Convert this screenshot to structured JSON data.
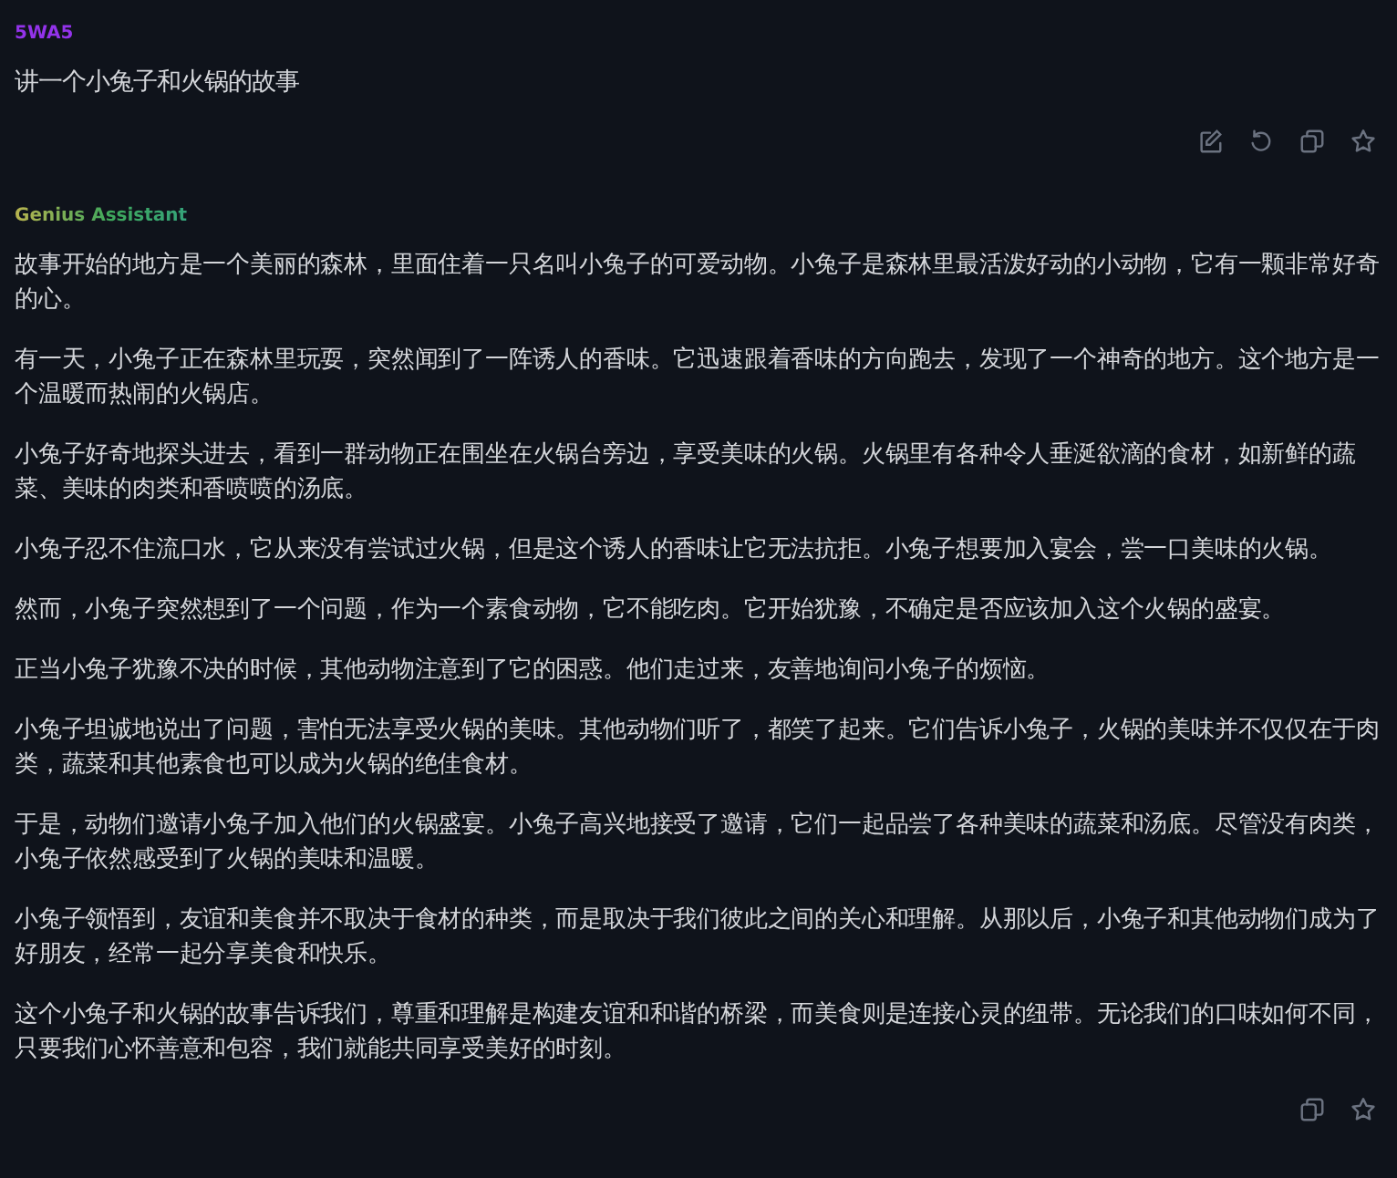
{
  "user_message": {
    "author": "5WA5",
    "text": "讲一个小兔子和火锅的故事",
    "actions": [
      {
        "kind": "edit"
      },
      {
        "kind": "regenerate"
      },
      {
        "kind": "copy"
      },
      {
        "kind": "favorite"
      }
    ]
  },
  "assistant_message": {
    "author": "Genius Assistant",
    "paragraphs": [
      "故事开始的地方是一个美丽的森林，里面住着一只名叫小兔子的可爱动物。小兔子是森林里最活泼好动的小动物，它有一颗非常好奇的心。",
      "有一天，小兔子正在森林里玩耍，突然闻到了一阵诱人的香味。它迅速跟着香味的方向跑去，发现了一个神奇的地方。这个地方是一个温暖而热闹的火锅店。",
      "小兔子好奇地探头进去，看到一群动物正在围坐在火锅台旁边，享受美味的火锅。火锅里有各种令人垂涎欲滴的食材，如新鲜的蔬菜、美味的肉类和香喷喷的汤底。",
      "小兔子忍不住流口水，它从来没有尝试过火锅，但是这个诱人的香味让它无法抗拒。小兔子想要加入宴会，尝一口美味的火锅。",
      "然而，小兔子突然想到了一个问题，作为一个素食动物，它不能吃肉。它开始犹豫，不确定是否应该加入这个火锅的盛宴。",
      "正当小兔子犹豫不决的时候，其他动物注意到了它的困惑。他们走过来，友善地询问小兔子的烦恼。",
      "小兔子坦诚地说出了问题，害怕无法享受火锅的美味。其他动物们听了，都笑了起来。它们告诉小兔子，火锅的美味并不仅仅在于肉类，蔬菜和其他素食也可以成为火锅的绝佳食材。",
      "于是，动物们邀请小兔子加入他们的火锅盛宴。小兔子高兴地接受了邀请，它们一起品尝了各种美味的蔬菜和汤底。尽管没有肉类，小兔子依然感受到了火锅的美味和温暖。",
      "小兔子领悟到，友谊和美食并不取决于食材的种类，而是取决于我们彼此之间的关心和理解。从那以后，小兔子和其他动物们成为了好朋友，经常一起分享美食和快乐。",
      "这个小兔子和火锅的故事告诉我们，尊重和理解是构建友谊和和谐的桥梁，而美食则是连接心灵的纽带。无论我们的口味如何不同，只要我们心怀善意和包容，我们就能共同享受美好的时刻。"
    ],
    "actions": [
      {
        "kind": "copy"
      },
      {
        "kind": "favorite"
      }
    ]
  }
}
